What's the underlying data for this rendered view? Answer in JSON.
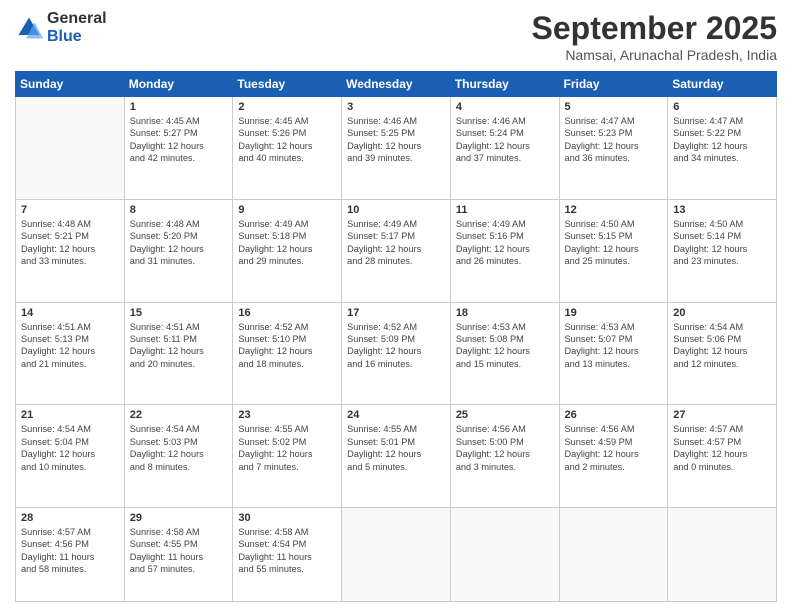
{
  "logo": {
    "general": "General",
    "blue": "Blue"
  },
  "title": "September 2025",
  "location": "Namsai, Arunachal Pradesh, India",
  "days_of_week": [
    "Sunday",
    "Monday",
    "Tuesday",
    "Wednesday",
    "Thursday",
    "Friday",
    "Saturday"
  ],
  "weeks": [
    [
      {
        "day": "",
        "info": ""
      },
      {
        "day": "1",
        "info": "Sunrise: 4:45 AM\nSunset: 5:27 PM\nDaylight: 12 hours\nand 42 minutes."
      },
      {
        "day": "2",
        "info": "Sunrise: 4:45 AM\nSunset: 5:26 PM\nDaylight: 12 hours\nand 40 minutes."
      },
      {
        "day": "3",
        "info": "Sunrise: 4:46 AM\nSunset: 5:25 PM\nDaylight: 12 hours\nand 39 minutes."
      },
      {
        "day": "4",
        "info": "Sunrise: 4:46 AM\nSunset: 5:24 PM\nDaylight: 12 hours\nand 37 minutes."
      },
      {
        "day": "5",
        "info": "Sunrise: 4:47 AM\nSunset: 5:23 PM\nDaylight: 12 hours\nand 36 minutes."
      },
      {
        "day": "6",
        "info": "Sunrise: 4:47 AM\nSunset: 5:22 PM\nDaylight: 12 hours\nand 34 minutes."
      }
    ],
    [
      {
        "day": "7",
        "info": "Sunrise: 4:48 AM\nSunset: 5:21 PM\nDaylight: 12 hours\nand 33 minutes."
      },
      {
        "day": "8",
        "info": "Sunrise: 4:48 AM\nSunset: 5:20 PM\nDaylight: 12 hours\nand 31 minutes."
      },
      {
        "day": "9",
        "info": "Sunrise: 4:49 AM\nSunset: 5:18 PM\nDaylight: 12 hours\nand 29 minutes."
      },
      {
        "day": "10",
        "info": "Sunrise: 4:49 AM\nSunset: 5:17 PM\nDaylight: 12 hours\nand 28 minutes."
      },
      {
        "day": "11",
        "info": "Sunrise: 4:49 AM\nSunset: 5:16 PM\nDaylight: 12 hours\nand 26 minutes."
      },
      {
        "day": "12",
        "info": "Sunrise: 4:50 AM\nSunset: 5:15 PM\nDaylight: 12 hours\nand 25 minutes."
      },
      {
        "day": "13",
        "info": "Sunrise: 4:50 AM\nSunset: 5:14 PM\nDaylight: 12 hours\nand 23 minutes."
      }
    ],
    [
      {
        "day": "14",
        "info": "Sunrise: 4:51 AM\nSunset: 5:13 PM\nDaylight: 12 hours\nand 21 minutes."
      },
      {
        "day": "15",
        "info": "Sunrise: 4:51 AM\nSunset: 5:11 PM\nDaylight: 12 hours\nand 20 minutes."
      },
      {
        "day": "16",
        "info": "Sunrise: 4:52 AM\nSunset: 5:10 PM\nDaylight: 12 hours\nand 18 minutes."
      },
      {
        "day": "17",
        "info": "Sunrise: 4:52 AM\nSunset: 5:09 PM\nDaylight: 12 hours\nand 16 minutes."
      },
      {
        "day": "18",
        "info": "Sunrise: 4:53 AM\nSunset: 5:08 PM\nDaylight: 12 hours\nand 15 minutes."
      },
      {
        "day": "19",
        "info": "Sunrise: 4:53 AM\nSunset: 5:07 PM\nDaylight: 12 hours\nand 13 minutes."
      },
      {
        "day": "20",
        "info": "Sunrise: 4:54 AM\nSunset: 5:06 PM\nDaylight: 12 hours\nand 12 minutes."
      }
    ],
    [
      {
        "day": "21",
        "info": "Sunrise: 4:54 AM\nSunset: 5:04 PM\nDaylight: 12 hours\nand 10 minutes."
      },
      {
        "day": "22",
        "info": "Sunrise: 4:54 AM\nSunset: 5:03 PM\nDaylight: 12 hours\nand 8 minutes."
      },
      {
        "day": "23",
        "info": "Sunrise: 4:55 AM\nSunset: 5:02 PM\nDaylight: 12 hours\nand 7 minutes."
      },
      {
        "day": "24",
        "info": "Sunrise: 4:55 AM\nSunset: 5:01 PM\nDaylight: 12 hours\nand 5 minutes."
      },
      {
        "day": "25",
        "info": "Sunrise: 4:56 AM\nSunset: 5:00 PM\nDaylight: 12 hours\nand 3 minutes."
      },
      {
        "day": "26",
        "info": "Sunrise: 4:56 AM\nSunset: 4:59 PM\nDaylight: 12 hours\nand 2 minutes."
      },
      {
        "day": "27",
        "info": "Sunrise: 4:57 AM\nSunset: 4:57 PM\nDaylight: 12 hours\nand 0 minutes."
      }
    ],
    [
      {
        "day": "28",
        "info": "Sunrise: 4:57 AM\nSunset: 4:56 PM\nDaylight: 11 hours\nand 58 minutes."
      },
      {
        "day": "29",
        "info": "Sunrise: 4:58 AM\nSunset: 4:55 PM\nDaylight: 11 hours\nand 57 minutes."
      },
      {
        "day": "30",
        "info": "Sunrise: 4:58 AM\nSunset: 4:54 PM\nDaylight: 11 hours\nand 55 minutes."
      },
      {
        "day": "",
        "info": ""
      },
      {
        "day": "",
        "info": ""
      },
      {
        "day": "",
        "info": ""
      },
      {
        "day": "",
        "info": ""
      }
    ]
  ]
}
